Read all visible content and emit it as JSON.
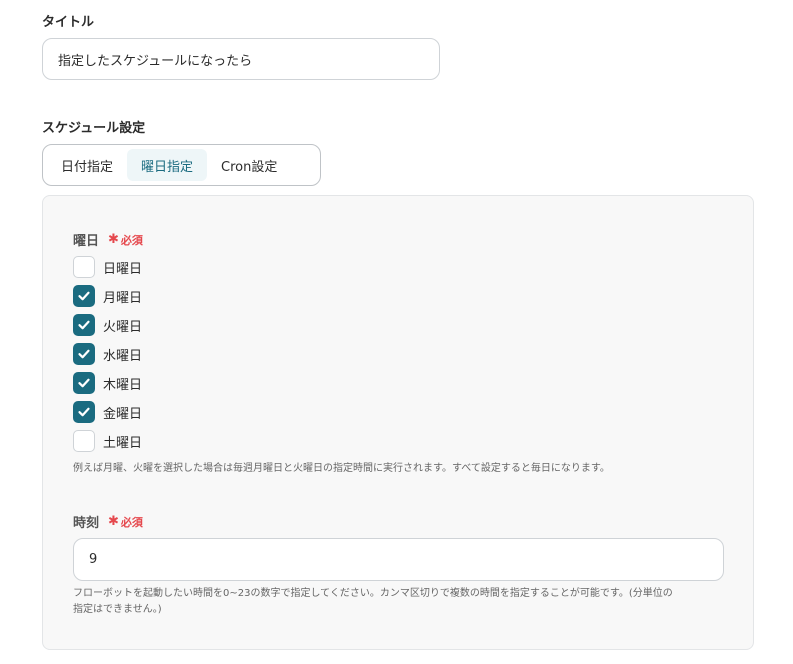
{
  "title_section": {
    "label": "タイトル",
    "input_value": "指定したスケジュールになったら"
  },
  "schedule_section": {
    "label": "スケジュール設定",
    "tabs": [
      {
        "label": "日付指定",
        "active": false
      },
      {
        "label": "曜日指定",
        "active": true
      },
      {
        "label": "Cron設定",
        "active": false
      }
    ]
  },
  "weekday_field": {
    "label": "曜日",
    "required_text": "必須",
    "days": [
      {
        "label": "日曜日",
        "checked": false
      },
      {
        "label": "月曜日",
        "checked": true
      },
      {
        "label": "火曜日",
        "checked": true
      },
      {
        "label": "水曜日",
        "checked": true
      },
      {
        "label": "木曜日",
        "checked": true
      },
      {
        "label": "金曜日",
        "checked": true
      },
      {
        "label": "土曜日",
        "checked": false
      }
    ],
    "hint": "例えば月曜、火曜を選択した場合は毎週月曜日と火曜日の指定時間に実行されます。すべて設定すると毎日になります。"
  },
  "time_field": {
    "label": "時刻",
    "required_text": "必須",
    "input_value": "9",
    "hint_line1": "フローボットを起動したい時間を0~23の数字で指定してください。カンマ区切りで複数の時間を指定することが可能です。(分単位の",
    "hint_line2": "指定はできません。)"
  },
  "colors": {
    "accent": "#1a6b80",
    "required": "#e5484d",
    "active_tab_bg": "#eef6f8"
  }
}
